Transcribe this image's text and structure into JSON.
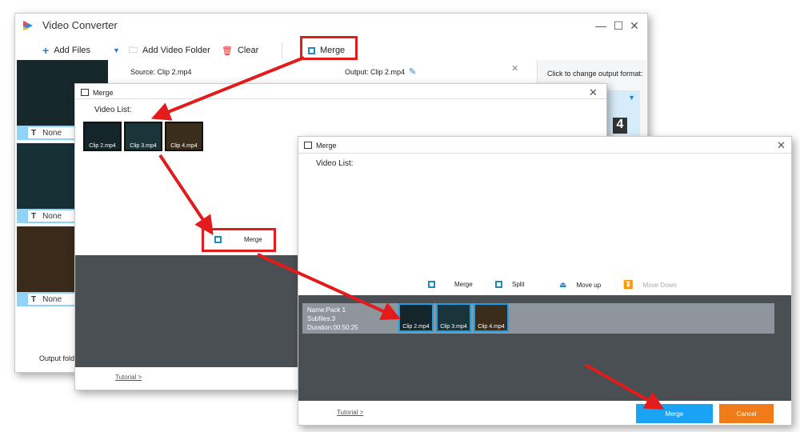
{
  "main_window": {
    "title": "Video Converter",
    "minimize": "—",
    "maximize": "☐",
    "close": "✕",
    "toolbar": {
      "add_files": "Add Files",
      "add_folder": "Add Video Folder",
      "clear": "Clear",
      "merge": "Merge"
    },
    "task": {
      "source": "Source: Clip 2.mp4",
      "output": "Output: Clip 2.mp4"
    },
    "subtitle_labels": [
      "None",
      "None",
      "None"
    ],
    "right_panel": {
      "format_hint": "Click to change output format:",
      "format_partial": "4"
    },
    "output_folder": "Output folde"
  },
  "merge_dialog_1": {
    "title": "Merge",
    "video_list_label": "Video List:",
    "clips": [
      "Clip 2.mp4",
      "Clip 3.mp4",
      "Clip 4.mp4"
    ],
    "merge_button": "Merge",
    "tutorial": "Tutorial >"
  },
  "merge_dialog_2": {
    "title": "Merge",
    "video_list_label": "Video List:",
    "actions": {
      "merge": "Merge",
      "split": "Split",
      "move_up": "Move up",
      "move_down": "Move Down"
    },
    "pack": {
      "name": "Name:Pack 1",
      "subfiles": "Subfiles:3",
      "duration": "Duration:00:50:25",
      "clips": [
        "Clip 2.mp4",
        "Clip 3.mp4",
        "Clip 4.mp4"
      ]
    },
    "tutorial": "Tutorial >",
    "merge_button": "Merge",
    "cancel_button": "Cancel"
  },
  "colors": {
    "highlight": "#e31b1b",
    "accent_blue": "#1aa3f4",
    "cancel_orange": "#f07c19",
    "dark_area": "#4a4f54"
  }
}
